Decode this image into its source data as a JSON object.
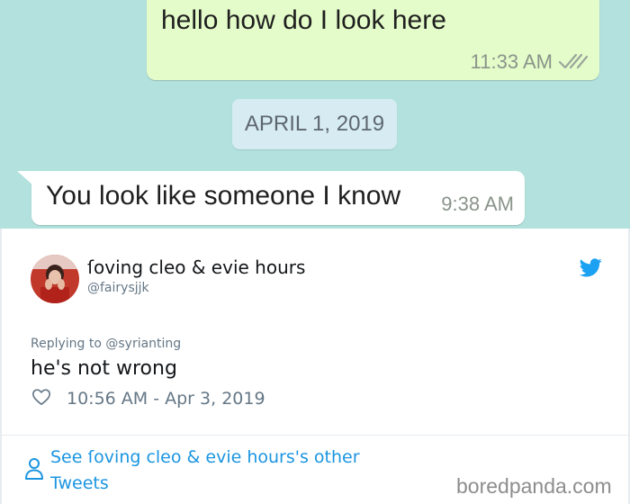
{
  "chat": {
    "outgoing": {
      "text": "hello how do I look here",
      "time": "11:33 AM"
    },
    "date_chip": "APRIL 1, 2019",
    "incoming": {
      "text": "You look like someone I know",
      "time": "9:38 AM"
    },
    "colors": {
      "background": "#b3e2de",
      "outgoing_bubble": "#e4fcc9",
      "date_chip": "#d7ecf2"
    }
  },
  "tweet": {
    "display_name": "ſoving cleo & evie hours",
    "handle": "@fairysjjk",
    "reply_to": "Replying to @syrianting",
    "text": "he's not wrong",
    "timestamp": "10:56 AM - Apr 3, 2019",
    "see_more": "See ſoving cleo & evie hours's other Tweets",
    "icons": [
      "twitter-bird-icon",
      "heart-icon",
      "person-icon"
    ],
    "accent_color": "#1da1f2"
  },
  "watermark": "boredpanda.com"
}
